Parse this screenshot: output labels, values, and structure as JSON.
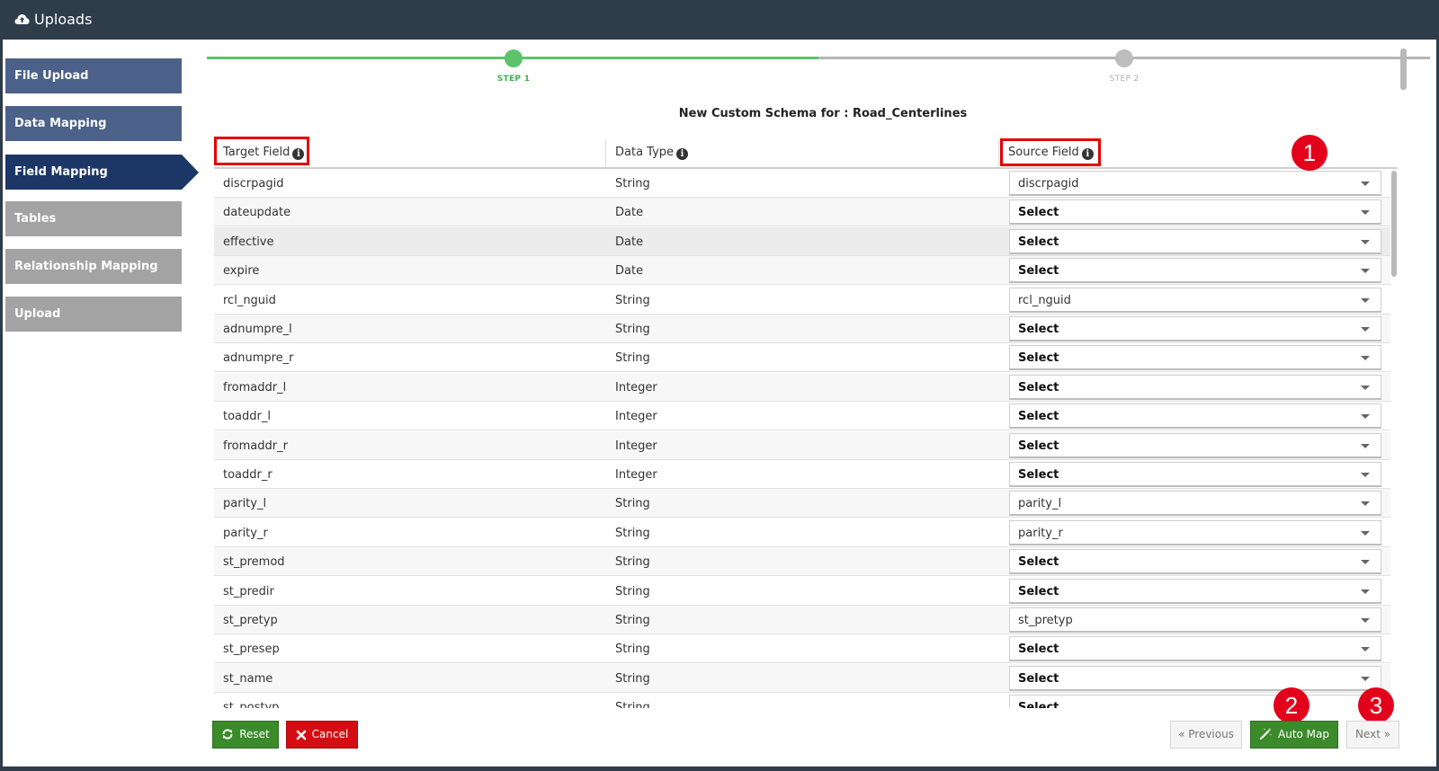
{
  "window": {
    "title": "Uploads",
    "icon": "cloud-upload-icon"
  },
  "sidebar": {
    "items": [
      {
        "label": "File Upload",
        "state": "done"
      },
      {
        "label": "Data Mapping",
        "state": "done"
      },
      {
        "label": "Field Mapping",
        "state": "active"
      },
      {
        "label": "Tables",
        "state": "pending"
      },
      {
        "label": "Relationship Mapping",
        "state": "pending"
      },
      {
        "label": "Upload",
        "state": "pending"
      }
    ]
  },
  "stepper": {
    "steps": [
      {
        "label": "STEP 1",
        "state": "current"
      },
      {
        "label": "STEP 2",
        "state": "pending"
      }
    ],
    "progress": 0.5
  },
  "schema_title": "New Custom Schema for : Road_Centerlines",
  "table": {
    "headers": {
      "target": "Target Field",
      "type": "Data Type",
      "source": "Source Field"
    },
    "rows": [
      {
        "target": "discrpagid",
        "type": "String",
        "source": "discrpagid",
        "mapped": true
      },
      {
        "target": "dateupdate",
        "type": "Date",
        "source": "Select",
        "mapped": false
      },
      {
        "target": "effective",
        "type": "Date",
        "source": "Select",
        "mapped": false
      },
      {
        "target": "expire",
        "type": "Date",
        "source": "Select",
        "mapped": false
      },
      {
        "target": "rcl_nguid",
        "type": "String",
        "source": "rcl_nguid",
        "mapped": true
      },
      {
        "target": "adnumpre_l",
        "type": "String",
        "source": "Select",
        "mapped": false
      },
      {
        "target": "adnumpre_r",
        "type": "String",
        "source": "Select",
        "mapped": false
      },
      {
        "target": "fromaddr_l",
        "type": "Integer",
        "source": "Select",
        "mapped": false
      },
      {
        "target": "toaddr_l",
        "type": "Integer",
        "source": "Select",
        "mapped": false
      },
      {
        "target": "fromaddr_r",
        "type": "Integer",
        "source": "Select",
        "mapped": false
      },
      {
        "target": "toaddr_r",
        "type": "Integer",
        "source": "Select",
        "mapped": false
      },
      {
        "target": "parity_l",
        "type": "String",
        "source": "parity_l",
        "mapped": true
      },
      {
        "target": "parity_r",
        "type": "String",
        "source": "parity_r",
        "mapped": true
      },
      {
        "target": "st_premod",
        "type": "String",
        "source": "Select",
        "mapped": false
      },
      {
        "target": "st_predir",
        "type": "String",
        "source": "Select",
        "mapped": false
      },
      {
        "target": "st_pretyp",
        "type": "String",
        "source": "st_pretyp",
        "mapped": true
      },
      {
        "target": "st_presep",
        "type": "String",
        "source": "Select",
        "mapped": false
      },
      {
        "target": "st_name",
        "type": "String",
        "source": "Select",
        "mapped": false
      },
      {
        "target": "st_postyp",
        "type": "String",
        "source": "Select",
        "mapped": false
      }
    ]
  },
  "annotations": {
    "badge1": "1",
    "badge2": "2",
    "badge3": "3"
  },
  "footer": {
    "reset": "Reset",
    "cancel": "Cancel",
    "previous": "« Previous",
    "auto_map": "Auto Map",
    "next": "Next »"
  },
  "colors": {
    "titlebar": "#2f3c4a",
    "nav_done": "#4b6189",
    "nav_active": "#1c3666",
    "nav_pending": "#a3a3a3",
    "step_green": "#5cc36b",
    "button_green": "#3b8b2b",
    "button_red": "#d40d12",
    "annotation_red": "#e3001b"
  }
}
